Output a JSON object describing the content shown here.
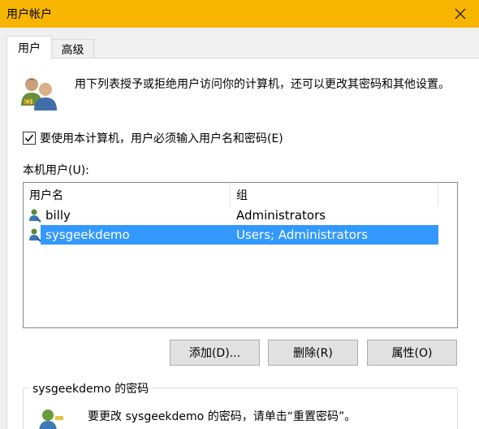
{
  "window": {
    "title": "用户帐户"
  },
  "tabs": [
    {
      "label": "用户",
      "active": true
    },
    {
      "label": "高级",
      "active": false
    }
  ],
  "intro": {
    "text": "用下列表授予或拒绝用户访问你的计算机，还可以更改其密码和其他设置。"
  },
  "require_login": {
    "label": "要使用本计算机，用户必须输入用户名和密码(E)",
    "checked": true
  },
  "users_section": {
    "label": "本机用户(U):",
    "columns": [
      "用户名",
      "组"
    ],
    "rows": [
      {
        "name": "billy",
        "group": "Administrators",
        "selected": false
      },
      {
        "name": "sysgeekdemo",
        "group": "Users; Administrators",
        "selected": true
      }
    ]
  },
  "buttons": {
    "add": "添加(D)...",
    "remove": "删除(R)",
    "properties": "属性(O)"
  },
  "password_group": {
    "title": "sysgeekdemo 的密码",
    "text": "要更改 sysgeekdemo 的密码，请单击“重置密码”。"
  },
  "colors": {
    "titlebar": "#f7b500",
    "selection": "#3399ff",
    "button_bg": "#e1e1e1"
  }
}
